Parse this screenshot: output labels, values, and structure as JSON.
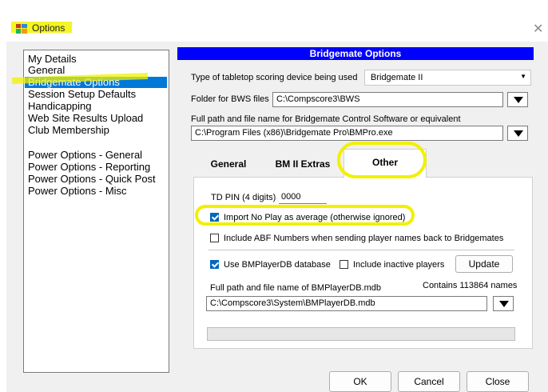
{
  "window": {
    "title": "Options",
    "close_glyph": "✕",
    "icon": "options-app-icon"
  },
  "sidebar": {
    "items": [
      "My Details",
      "General",
      "Bridgemate Options",
      "Session Setup Defaults",
      "Handicapping",
      "Web Site Results Upload",
      "Club Membership",
      "Power Options - General",
      "Power Options - Reporting",
      "Power Options - Quick Post",
      "Power Options - Misc"
    ],
    "selected": "Bridgemate Options"
  },
  "panel": {
    "title": "Bridgemate Options",
    "device_label": "Type of tabletop scoring device being used",
    "device_value": "Bridgemate II",
    "bws_label": "Folder for BWS files",
    "bws_value": "C:\\Compscore3\\BWS",
    "software_label": "Full path and file name for Bridgemate Control Software or equivalent",
    "software_value": "C:\\Program Files (x86)\\Bridgemate Pro\\BMPro.exe"
  },
  "tabs": [
    "General",
    "BM II Extras",
    "Other"
  ],
  "active_tab": "Other",
  "other": {
    "td_pin_label": "TD PIN (4 digits)",
    "td_pin_value": "0000",
    "import_no_play": {
      "label": "Import No Play as average (otherwise ignored)",
      "checked": true
    },
    "include_abf": {
      "label": "Include ABF Numbers when sending player names back to Bridgemates",
      "checked": false
    },
    "use_bmplayerdb": {
      "label": "Use BMPlayerDB database",
      "checked": true
    },
    "include_inactive": {
      "label": "Include inactive players",
      "checked": false
    },
    "update_label": "Update",
    "db_path_label": "Full path and file name of BMPlayerDB.mdb",
    "contains_label": "Contains 113864 names",
    "db_path_value": "C:\\Compscore3\\System\\BMPlayerDB.mdb"
  },
  "buttons": {
    "ok": "OK",
    "cancel": "Cancel",
    "close": "Close"
  },
  "colors": {
    "accent": "#0000ff",
    "selection": "#0078d7",
    "highlighter": "#f2f200"
  }
}
